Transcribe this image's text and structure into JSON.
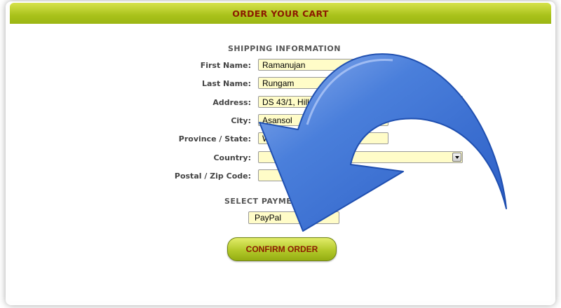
{
  "header": {
    "title": "ORDER YOUR CART"
  },
  "shipping": {
    "section_title": "SHIPPING INFORMATION",
    "fields": [
      {
        "label": "First Name:",
        "value": "Ramanujan"
      },
      {
        "label": "Last Name:",
        "value": "Rungam"
      },
      {
        "label": "Address:",
        "value": "DS 43/1, Hill View"
      },
      {
        "label": "City:",
        "value": "Asansol"
      },
      {
        "label": "Province / State:",
        "value": "West Bengal"
      },
      {
        "label": "Country:",
        "value": ""
      },
      {
        "label": "Postal / Zip Code:",
        "value": ""
      }
    ]
  },
  "payment": {
    "section_title": "SELECT PAYMENT",
    "selected": "PayPal"
  },
  "confirm_button": {
    "label": "CONFIRM ORDER"
  },
  "overlay": {
    "icon": "curved-arrow-icon",
    "color": "#3f78d6"
  },
  "colors": {
    "accent": "#a9c21a",
    "title_text": "#8b1a00",
    "input_bg": "#fffcc8"
  }
}
